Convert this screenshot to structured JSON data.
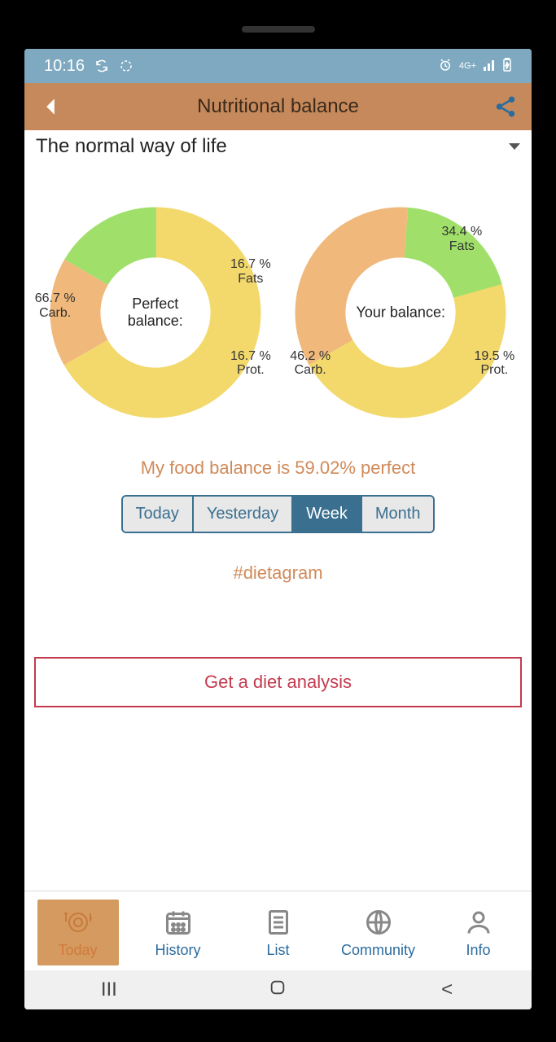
{
  "status": {
    "time": "10:16"
  },
  "header": {
    "title": "Nutritional balance"
  },
  "dropdown": {
    "selected": "The normal way of life"
  },
  "charts": {
    "perfect": {
      "label": "Perfect balance:",
      "fats": {
        "pct": "16.7 %",
        "caption": "Fats"
      },
      "carb": {
        "pct": "66.7 %",
        "caption": "Carb."
      },
      "prot": {
        "pct": "16.7 %",
        "caption": "Prot."
      }
    },
    "your": {
      "label": "Your balance:",
      "fats": {
        "pct": "34.4 %",
        "caption": "Fats"
      },
      "carb": {
        "pct": "46.2 %",
        "caption": "Carb."
      },
      "prot": {
        "pct": "19.5 %",
        "caption": "Prot."
      }
    }
  },
  "chart_data": [
    {
      "type": "pie",
      "title": "Perfect balance:",
      "series": [
        {
          "name": "Carb.",
          "value": 66.7
        },
        {
          "name": "Fats",
          "value": 16.7
        },
        {
          "name": "Prot.",
          "value": 16.7
        }
      ]
    },
    {
      "type": "pie",
      "title": "Your balance:",
      "series": [
        {
          "name": "Carb.",
          "value": 46.2
        },
        {
          "name": "Fats",
          "value": 34.4
        },
        {
          "name": "Prot.",
          "value": 19.5
        }
      ]
    }
  ],
  "balance_summary": "My food balance is 59.02% perfect",
  "segments": {
    "today": "Today",
    "yesterday": "Yesterday",
    "week": "Week",
    "month": "Month"
  },
  "hashtag": "#dietagram",
  "cta": "Get a diet analysis",
  "nav": {
    "today": "Today",
    "history": "History",
    "list": "List",
    "community": "Community",
    "info": "Info"
  }
}
